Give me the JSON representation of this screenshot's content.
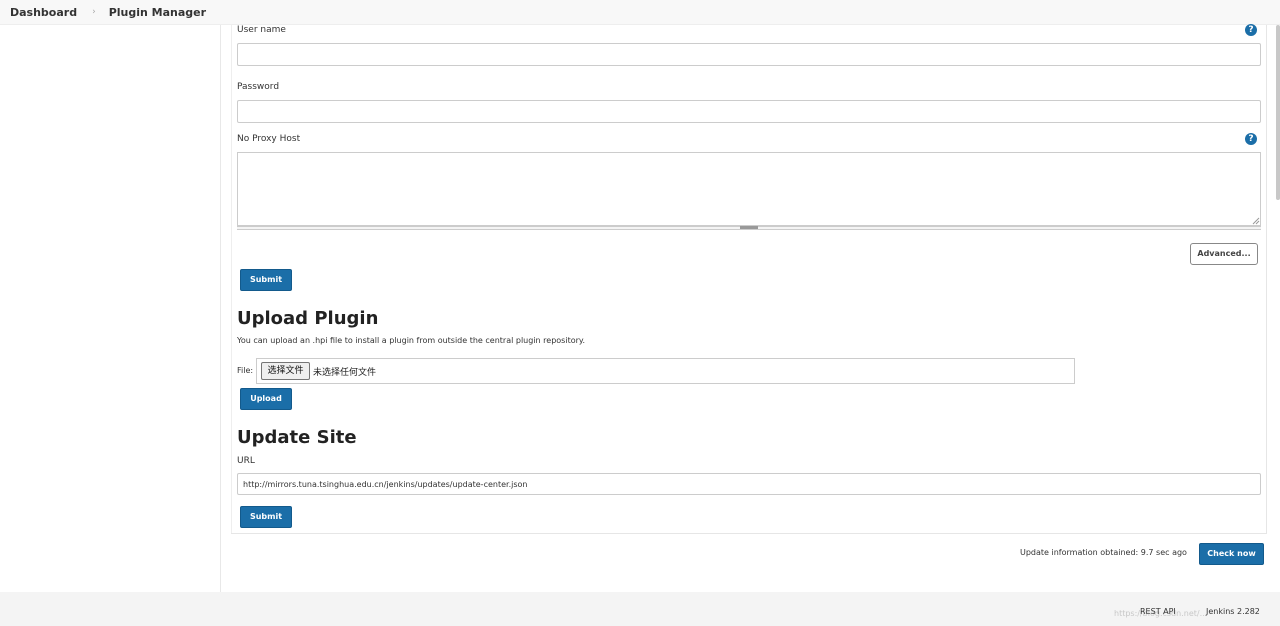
{
  "breadcrumb": {
    "items": [
      "Dashboard",
      "Plugin Manager"
    ],
    "separator": "›"
  },
  "proxy": {
    "username_label": "User name",
    "username_value": "",
    "password_label": "Password",
    "password_value": "",
    "no_proxy_label": "No Proxy Host",
    "no_proxy_value": "",
    "help_glyph": "?",
    "advanced_label": "Advanced...",
    "submit_label": "Submit"
  },
  "upload": {
    "title": "Upload Plugin",
    "description": "You can upload an .hpi file to install a plugin from outside the central plugin repository.",
    "file_label": "File:",
    "choose_button": "选择文件",
    "no_file_text": "未选择任何文件",
    "button_label": "Upload"
  },
  "update_site": {
    "title": "Update Site",
    "url_label": "URL",
    "url_value": "http://mirrors.tuna.tsinghua.edu.cn/jenkins/updates/update-center.json",
    "submit_label": "Submit"
  },
  "status": {
    "text": "Update information obtained: 9.7 sec ago",
    "check_now_label": "Check now"
  },
  "footer": {
    "rest_api": "REST API",
    "version": "Jenkins 2.282",
    "watermark": "https://blog.csdn.net/..."
  },
  "colors": {
    "primary": "#1b6ea8",
    "help_icon": "#1b6ea8"
  },
  "icons": {
    "help": "help-icon",
    "resize": "resize-handle-icon"
  }
}
